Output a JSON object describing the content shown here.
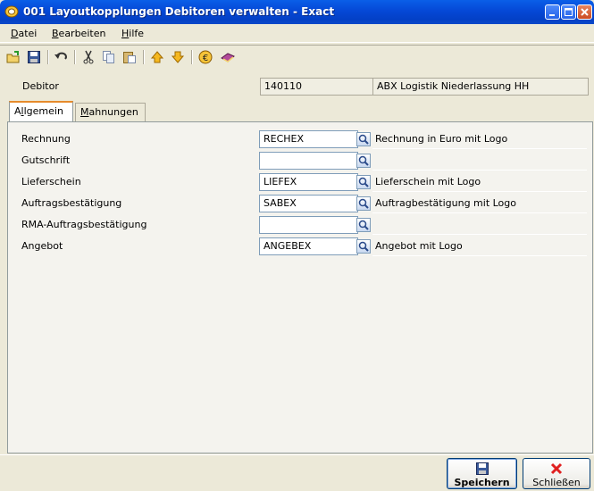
{
  "window": {
    "title": "001 Layoutkopplungen Debitoren verwalten - Exact"
  },
  "menu": {
    "items": [
      {
        "label": "Datei",
        "accel": "D",
        "rest": "atei"
      },
      {
        "label": "Bearbeiten",
        "accel": "B",
        "rest": "earbeiten"
      },
      {
        "label": "Hilfe",
        "accel": "H",
        "rest": "ilfe"
      }
    ]
  },
  "toolbar": {
    "icons": [
      "open-folder-icon",
      "save-disk-icon",
      "undo-icon",
      "cut-icon",
      "copy-icon",
      "paste-icon",
      "arrow-up-icon",
      "arrow-down-icon",
      "euro-icon",
      "book-icon"
    ]
  },
  "debitor": {
    "label": "Debitor",
    "code": "140110",
    "name": "ABX Logistik Niederlassung HH"
  },
  "tabs": [
    {
      "label": "Allgemein",
      "accel": "l",
      "pre": "A",
      "post": "lgemein"
    },
    {
      "label": "Mahnungen",
      "accel": "M",
      "pre": "",
      "post": "ahnungen"
    }
  ],
  "rows": [
    {
      "label": "Rechnung",
      "value": "RECHEX",
      "description": "Rechnung in Euro mit Logo"
    },
    {
      "label": "Gutschrift",
      "value": "",
      "description": ""
    },
    {
      "label": "Lieferschein",
      "value": "LIEFEX",
      "description": "Lieferschein mit Logo"
    },
    {
      "label": "Auftragsbestätigung",
      "value": "SABEX",
      "description": "Auftragbestätigung mit Logo"
    },
    {
      "label": "RMA-Auftragsbestätigung",
      "value": "",
      "description": ""
    },
    {
      "label": "Angebot",
      "value": "ANGEBEX",
      "description": "Angebot mit Logo"
    }
  ],
  "buttons": {
    "save": "Speichern",
    "close": "Schließen"
  },
  "colors": {
    "titlebar": "#0548D6",
    "tab_accent": "#E68B2C",
    "close_x": "#E02020"
  }
}
